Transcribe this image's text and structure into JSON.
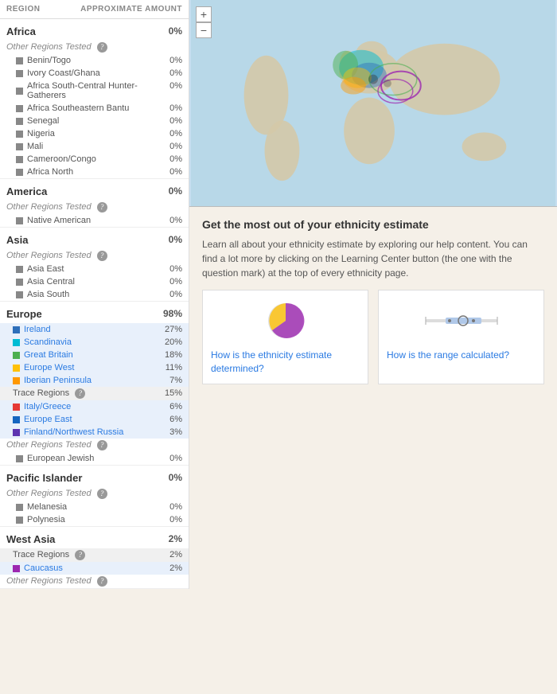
{
  "header": {
    "region_label": "Region",
    "amount_label": "Approximate Amount"
  },
  "sections": [
    {
      "id": "africa",
      "name": "Africa",
      "pct": "0%",
      "other_tested": true,
      "sub_items": [
        {
          "name": "Benin/Togo",
          "pct": "0%",
          "color": "#888",
          "link": false
        },
        {
          "name": "Ivory Coast/Ghana",
          "pct": "0%",
          "color": "#888",
          "link": false
        },
        {
          "name": "Africa South-Central Hunter-Gatherers",
          "pct": "0%",
          "color": "#888",
          "link": false
        },
        {
          "name": "Africa Southeastern Bantu",
          "pct": "0%",
          "color": "#888",
          "link": false
        },
        {
          "name": "Senegal",
          "pct": "0%",
          "color": "#888",
          "link": false
        },
        {
          "name": "Nigeria",
          "pct": "0%",
          "color": "#888",
          "link": false
        },
        {
          "name": "Mali",
          "pct": "0%",
          "color": "#888",
          "link": false
        },
        {
          "name": "Cameroon/Congo",
          "pct": "0%",
          "color": "#888",
          "link": false
        },
        {
          "name": "Africa North",
          "pct": "0%",
          "color": "#888",
          "link": false
        }
      ]
    },
    {
      "id": "america",
      "name": "America",
      "pct": "0%",
      "other_tested": true,
      "sub_items": [
        {
          "name": "Native American",
          "pct": "0%",
          "color": "#888",
          "link": false
        }
      ]
    },
    {
      "id": "asia",
      "name": "Asia",
      "pct": "0%",
      "other_tested": true,
      "sub_items": [
        {
          "name": "Asia East",
          "pct": "0%",
          "color": "#888",
          "link": false
        },
        {
          "name": "Asia Central",
          "pct": "0%",
          "color": "#888",
          "link": false
        },
        {
          "name": "Asia South",
          "pct": "0%",
          "color": "#888",
          "link": false
        }
      ]
    },
    {
      "id": "europe",
      "name": "Europe",
      "pct": "98%",
      "other_tested": true,
      "main_items": [
        {
          "name": "Ireland",
          "pct": "27%",
          "color": "#2e6fba",
          "link": true,
          "highlight": true
        },
        {
          "name": "Scandinavia",
          "pct": "20%",
          "color": "#00bcd4",
          "link": true,
          "highlight": true
        },
        {
          "name": "Great Britain",
          "pct": "18%",
          "color": "#4caf50",
          "link": true,
          "highlight": true
        },
        {
          "name": "Europe West",
          "pct": "11%",
          "color": "#ffc107",
          "link": true,
          "highlight": true
        },
        {
          "name": "Iberian Peninsula",
          "pct": "7%",
          "color": "#ff9800",
          "link": true,
          "highlight": true
        }
      ],
      "trace_label": "Trace Regions",
      "trace_pct": "15%",
      "trace_items": [
        {
          "name": "Italy/Greece",
          "pct": "6%",
          "color": "#e53935",
          "link": true,
          "highlight": true
        },
        {
          "name": "Europe East",
          "pct": "6%",
          "color": "#1565c0",
          "link": true,
          "highlight": true
        },
        {
          "name": "Finland/Northwest Russia",
          "pct": "3%",
          "color": "#5e35b1",
          "link": true,
          "highlight": true
        }
      ],
      "sub_items": [
        {
          "name": "European Jewish",
          "pct": "0%",
          "color": "#888",
          "link": false
        }
      ]
    },
    {
      "id": "pacific_islander",
      "name": "Pacific Islander",
      "pct": "0%",
      "other_tested": true,
      "sub_items": [
        {
          "name": "Melanesia",
          "pct": "0%",
          "color": "#888",
          "link": false
        },
        {
          "name": "Polynesia",
          "pct": "0%",
          "color": "#888",
          "link": false
        }
      ]
    },
    {
      "id": "west_asia",
      "name": "West Asia",
      "pct": "2%",
      "other_tested": false,
      "trace_label": "Trace Regions",
      "trace_pct": "2%",
      "trace_items": [
        {
          "name": "Caucasus",
          "pct": "2%",
          "color": "#9c27b0",
          "link": true,
          "highlight": true
        }
      ],
      "other_tested_end": true
    }
  ],
  "map": {
    "zoom_in": "+",
    "zoom_out": "−"
  },
  "info": {
    "title": "Get the most out of your ethnicity estimate",
    "text": "Learn all about your ethnicity estimate by exploring our help content. You can find a lot more by clicking on the Learning Center button (the one with the question mark) at the top of every ethnicity page.",
    "card1_link": "How is the ethnicity estimate determined?",
    "card2_link": "How is the range calculated?"
  }
}
